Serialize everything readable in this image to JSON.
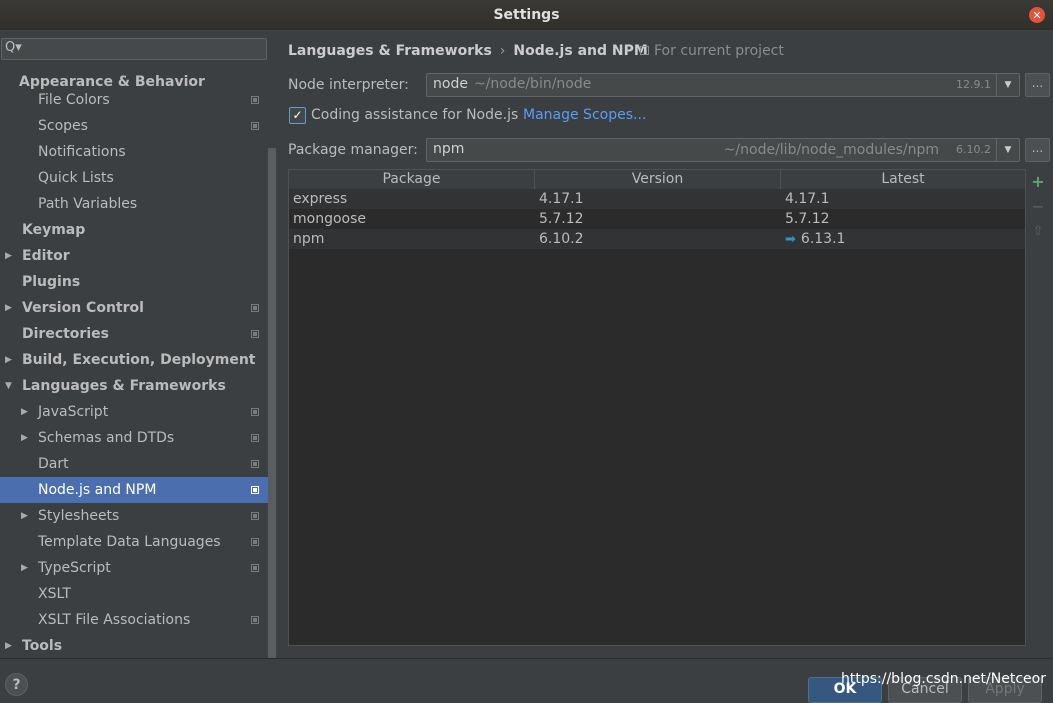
{
  "window": {
    "title": "Settings",
    "close_glyph": "✕"
  },
  "search": {
    "icon": "Q▾",
    "value": "",
    "placeholder": ""
  },
  "sidebar": {
    "items": [
      {
        "label": "Appearance & Behavior"
      },
      {
        "label": "File Colors"
      },
      {
        "label": "Scopes"
      },
      {
        "label": "Notifications"
      },
      {
        "label": "Quick Lists"
      },
      {
        "label": "Path Variables"
      },
      {
        "label": "Keymap"
      },
      {
        "label": "Editor"
      },
      {
        "label": "Plugins"
      },
      {
        "label": "Version Control"
      },
      {
        "label": "Directories"
      },
      {
        "label": "Build, Execution, Deployment"
      },
      {
        "label": "Languages & Frameworks"
      },
      {
        "label": "JavaScript"
      },
      {
        "label": "Schemas and DTDs"
      },
      {
        "label": "Dart"
      },
      {
        "label": "Node.js and NPM"
      },
      {
        "label": "Stylesheets"
      },
      {
        "label": "Template Data Languages"
      },
      {
        "label": "TypeScript"
      },
      {
        "label": "XSLT"
      },
      {
        "label": "XSLT File Associations"
      },
      {
        "label": "Tools"
      }
    ]
  },
  "breadcrumb": {
    "parent": "Languages & Frameworks",
    "separator": "›",
    "current": "Node.js and NPM",
    "scope_label": "For current project"
  },
  "node": {
    "label": "Node interpreter:",
    "value": "node",
    "path": "~/node/bin/node",
    "version": "12.9.1",
    "more_label": "..."
  },
  "coding": {
    "checked_glyph": "✓",
    "label": "Coding assistance for Node.js",
    "link": "Manage Scopes..."
  },
  "package_manager": {
    "label": "Package manager:",
    "value": "npm",
    "path": "~/node/lib/node_modules/npm",
    "version": "6.10.2",
    "more_label": "..."
  },
  "table": {
    "columns": [
      "Package",
      "Version",
      "Latest"
    ],
    "rows": [
      {
        "package": "express",
        "version": "4.17.1",
        "latest": "4.17.1",
        "upgrade": ""
      },
      {
        "package": "mongoose",
        "version": "5.7.12",
        "latest": "5.7.12",
        "upgrade": ""
      },
      {
        "package": "npm",
        "version": "6.10.2",
        "latest": "6.13.1",
        "upgrade": "➡"
      }
    ],
    "add_glyph": "+",
    "remove_glyph": "−",
    "upgrade_glyph": "⇧"
  },
  "footer": {
    "help": "?",
    "ok": "OK",
    "cancel": "Cancel",
    "apply": "Apply"
  },
  "watermark": "https://blog.csdn.net/Netceor",
  "colors": {
    "accent": "#4b6eaf",
    "link": "#589df6",
    "add": "#59a869"
  }
}
